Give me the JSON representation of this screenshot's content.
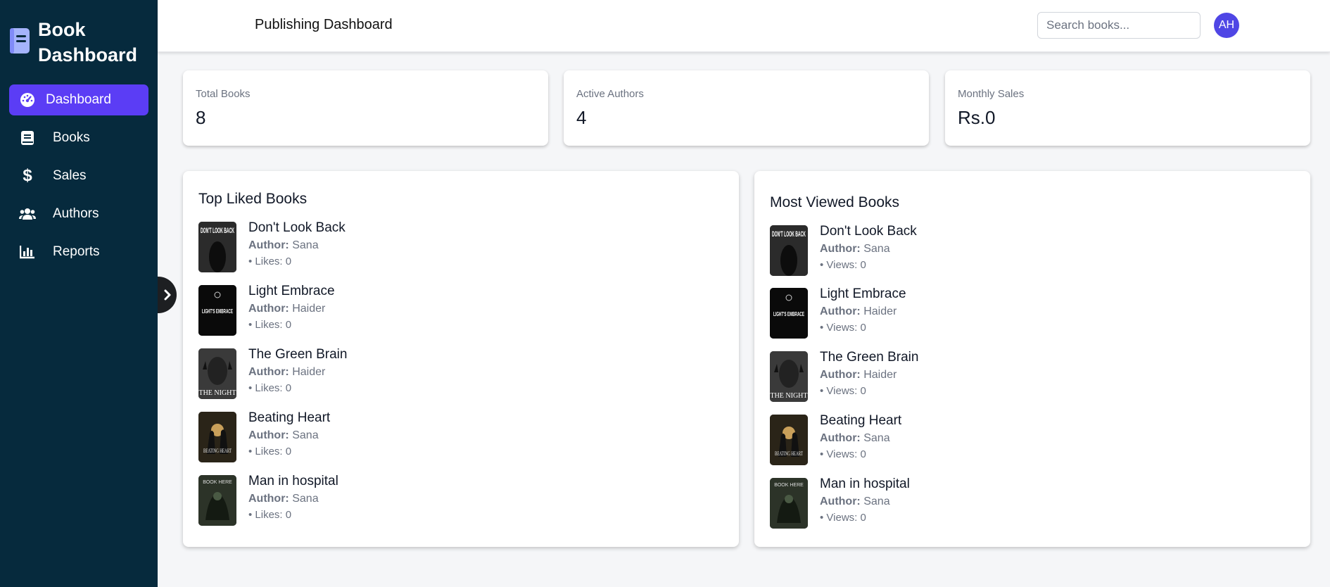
{
  "sidebar": {
    "brand": "Book Dashboard",
    "items": [
      {
        "label": "Dashboard",
        "icon": "gauge-icon",
        "active": true
      },
      {
        "label": "Books",
        "icon": "book-icon",
        "active": false
      },
      {
        "label": "Sales",
        "icon": "dollar-icon",
        "active": false
      },
      {
        "label": "Authors",
        "icon": "users-icon",
        "active": false
      },
      {
        "label": "Reports",
        "icon": "chart-bar-icon",
        "active": false
      }
    ]
  },
  "header": {
    "title": "Publishing Dashboard",
    "search_placeholder": "Search books...",
    "avatar_initials": "AH"
  },
  "stats": [
    {
      "label": "Total Books",
      "value": "8"
    },
    {
      "label": "Active Authors",
      "value": "4"
    },
    {
      "label": "Monthly Sales",
      "value": "Rs.0"
    }
  ],
  "author_prefix": "Author:",
  "top_liked": {
    "title": "Top Liked Books",
    "books": [
      {
        "title": "Don't Look Back",
        "author": "Sana",
        "stat": "• Likes: 0"
      },
      {
        "title": "Light Embrace",
        "author": "Haider",
        "stat": "• Likes: 0"
      },
      {
        "title": "The Green Brain",
        "author": "Haider",
        "stat": "• Likes: 0"
      },
      {
        "title": "Beating Heart",
        "author": "Sana",
        "stat": "• Likes: 0"
      },
      {
        "title": "Man in hospital",
        "author": "Sana",
        "stat": "• Likes: 0"
      }
    ]
  },
  "most_viewed": {
    "title": "Most Viewed Books",
    "books": [
      {
        "title": "Don't Look Back",
        "author": "Sana",
        "stat": "• Views: 0"
      },
      {
        "title": "Light Embrace",
        "author": "Haider",
        "stat": "• Views: 0"
      },
      {
        "title": "The Green Brain",
        "author": "Haider",
        "stat": "• Views: 0"
      },
      {
        "title": "Beating Heart",
        "author": "Sana",
        "stat": "• Views: 0"
      },
      {
        "title": "Man in hospital",
        "author": "Sana",
        "stat": "• Views: 0"
      }
    ]
  },
  "cover_art": {
    "dont_look_back": "DON'T LOOK BACK",
    "light_embrace": "LIGHT'S EMBRACE",
    "the_night": "THE NIGHT",
    "beating_heart": "BEATING HEART",
    "book_here": "BOOK HERE"
  },
  "colors": {
    "sidebar_bg": "#062a3d",
    "active": "#5b3df5",
    "avatar": "#4f46e5"
  }
}
